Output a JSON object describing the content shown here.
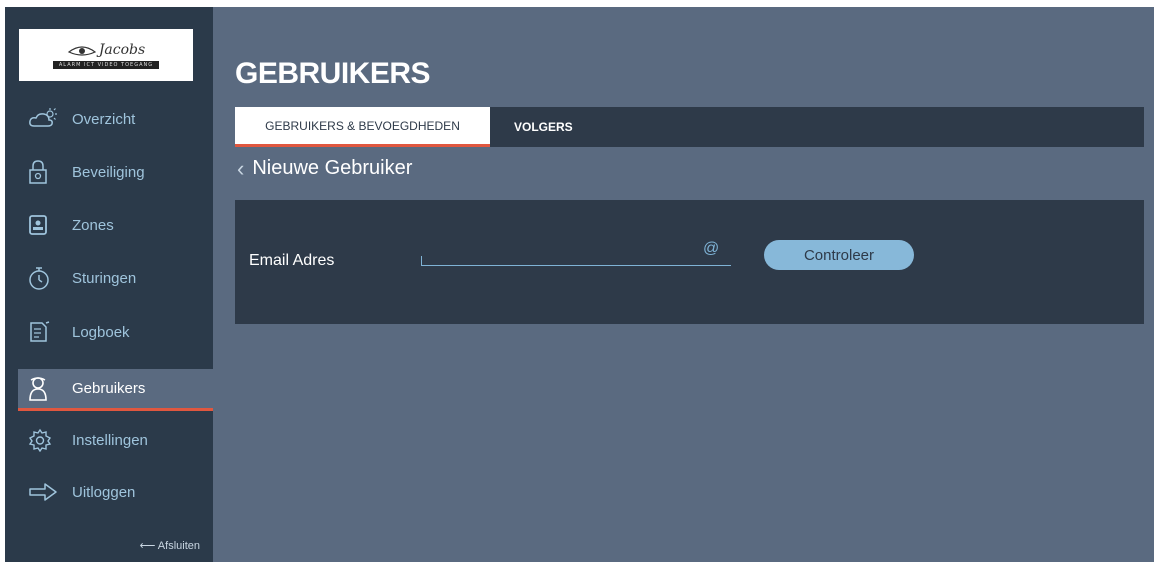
{
  "logo": {
    "name": "Jacobs",
    "tagline": "ALARM ICT VIDEO TOEGANG"
  },
  "sidebar": {
    "items": [
      {
        "label": "Overzicht",
        "icon": "weather-icon"
      },
      {
        "label": "Beveiliging",
        "icon": "lock-icon"
      },
      {
        "label": "Zones",
        "icon": "zone-icon"
      },
      {
        "label": "Sturingen",
        "icon": "timer-icon"
      },
      {
        "label": "Logboek",
        "icon": "log-icon"
      },
      {
        "label": "Gebruikers",
        "icon": "user-icon",
        "active": true
      },
      {
        "label": "Instellingen",
        "icon": "gear-icon"
      },
      {
        "label": "Uitloggen",
        "icon": "logout-arrow-icon"
      }
    ],
    "close_label": "⟵ Afsluiten"
  },
  "page": {
    "title": "GEBRUIKERS"
  },
  "tabs": [
    {
      "label": "GEBRUIKERS & BEVOEGDHEDEN",
      "active": true
    },
    {
      "label": "VOLGERS",
      "active": false
    }
  ],
  "back": {
    "label": "Nieuwe Gebruiker"
  },
  "form": {
    "email_label": "Email Adres",
    "email_value": "",
    "at_symbol": "@",
    "check_button": "Controleer"
  },
  "colors": {
    "sidebar_bg": "#2b3a4a",
    "main_bg": "#5a6a80",
    "panel_bg": "#2e3a49",
    "accent": "#e0573f",
    "link_blue": "#9fc4dc",
    "button_blue": "#87b8d9"
  }
}
